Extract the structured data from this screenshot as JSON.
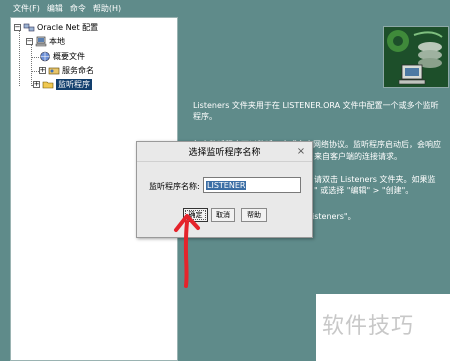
{
  "menu": {
    "items": [
      "文件(F)",
      "编辑",
      "命令",
      "帮助(H)"
    ]
  },
  "tree": {
    "root": "Oracle Net 配置",
    "local": "本地",
    "profile": "概要文件",
    "naming": "服务命名",
    "listener": "监听程序"
  },
  "description": {
    "p1": "Listeners 文件夹用于在 LISTENER.ORA 文件中配置一个或多个监听程序。",
    "p2_left": "每个监听程序可以监听一个或多个网络协议。监听程序启动后，会响应",
    "p2_right": "来自客户端的连接请求。",
    "p3_right": "请双击 Listeners 文件夹。如果监",
    "p3_right2": "\" 或选择 \"编辑\" > \"创建\"。",
    "p3_tail": "isteners\"。"
  },
  "dialog": {
    "title": "选择监听程序名称",
    "close": "×",
    "field_label": "监听程序名称:",
    "field_value": "LISTENER",
    "ok": "确定",
    "cancel": "取消",
    "help": "帮助"
  },
  "watermark": "软件技巧",
  "colors": {
    "background": "#5f8b8a",
    "selection": "#123f6d",
    "arrow": "#e5232b"
  }
}
